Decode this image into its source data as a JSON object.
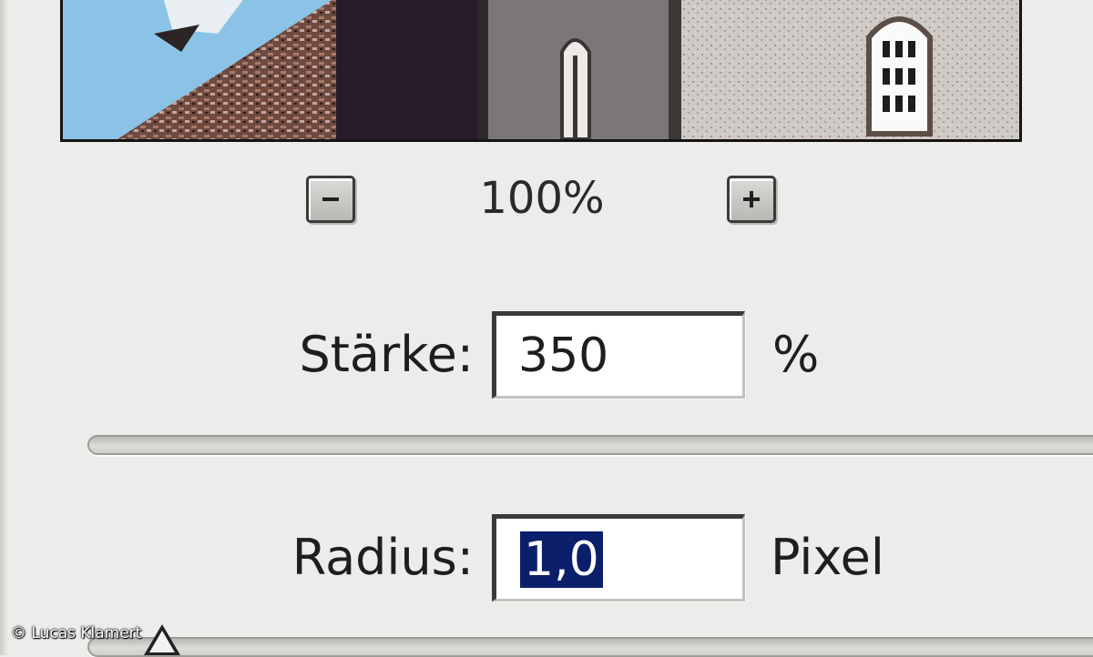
{
  "preview": {
    "sky_color": "#8ac3e6"
  },
  "zoom": {
    "value": "100%",
    "zoom_out_icon": "minus-icon",
    "zoom_in_icon": "plus-icon"
  },
  "amount": {
    "label": "Stärke:",
    "value": "350",
    "unit": "%"
  },
  "radius": {
    "label": "Radius:",
    "value": "1,0",
    "unit": "Pixel"
  },
  "colors": {
    "selection": "#0c1f6a",
    "dialog_background": "#ececea"
  },
  "watermark": "© Lucas Klamert"
}
